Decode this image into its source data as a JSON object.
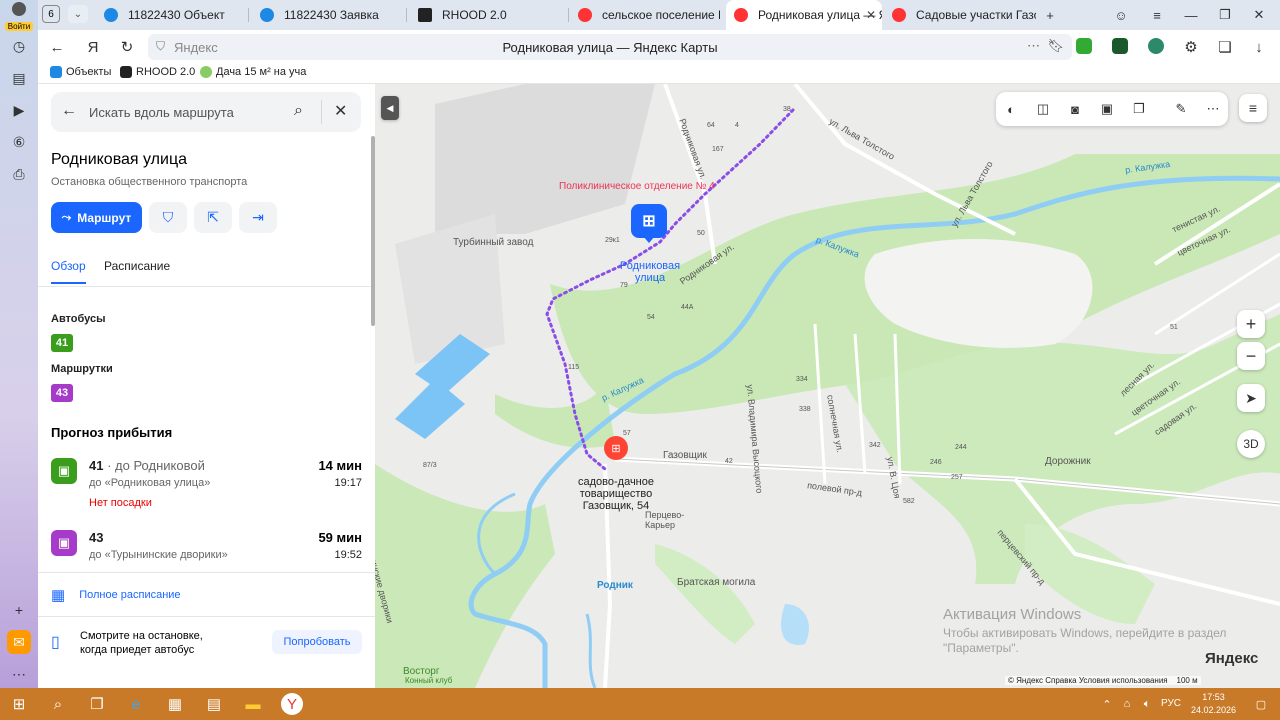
{
  "browser": {
    "login_label": "Войти",
    "tab_count": "6",
    "tabs": [
      {
        "title": "11822430 Объект",
        "active": false
      },
      {
        "title": "11822430 Заявка",
        "active": false
      },
      {
        "title": "RHOOD 2.0",
        "active": false
      },
      {
        "title": "сельское поселение Кра",
        "active": false
      },
      {
        "title": "Родниковая улица — Я",
        "active": true
      },
      {
        "title": "Садовые участки Газови",
        "active": false
      }
    ],
    "url_domain": "Яндекс",
    "page_title": "Родниковая улица — Яндекс Карты",
    "bookmarks": [
      "Объекты",
      "RHOOD 2.0",
      "Дача 15 м² на уча"
    ]
  },
  "panel": {
    "search_placeholder": "Искать вдоль маршрута",
    "title": "Родниковая улица",
    "subtitle": "Остановка общественного транспорта",
    "route_button": "Маршрут",
    "tabs": [
      "Обзор",
      "Расписание"
    ],
    "buses_label": "Автобусы",
    "bus_number": "41",
    "minibus_label": "Маршрутки",
    "minibus_number": "43",
    "forecast_title": "Прогноз прибытия",
    "arrivals": [
      {
        "number": "41",
        "direction": " · до Родниковой",
        "destination": "до «Родниковая улица»",
        "warning": "Нет посадки",
        "minutes": "14 мин",
        "time": "19:17"
      },
      {
        "number": "43",
        "direction": "",
        "destination": "до «Турынинские дворики»",
        "warning": "",
        "minutes": "59 мин",
        "time": "19:52"
      }
    ],
    "full_schedule": "Полное расписание",
    "promo_text": "Смотрите на остановке, когда приедет автобус",
    "promo_button": "Попробовать"
  },
  "map": {
    "stop_label": "Родниковая улица",
    "destination_label": "садово-дачное товарищество Газовщик, 54",
    "labels": {
      "clinic": "Поликлиническое отделение № 4",
      "factory": "Турбинный завод",
      "river1": "р. Калужка",
      "river2": "р. Калужка",
      "river3": "р. Калужка",
      "tolstoy": "ул. Льва Толстого",
      "tolstoy2": "ул. Льва Толстого",
      "rodnikovaya": "Родниковая ул.",
      "rodnikovaya2": "Родниковая ул.",
      "gazovshchik": "Газовщик",
      "pertsevo": "Перцево-Карьер",
      "rodnik": "Родник",
      "grave": "Братская могила",
      "polevoy": "полевой пр-д",
      "pertsevsky": "перцевский пр-д",
      "dorozhnik": "Дорожник",
      "vostorg": "Восторг",
      "vostorg_sub": "Конный клуб",
      "vysotsky": "ул. Владимира Высоцкого",
      "solnechnaya": "солнечная ул.",
      "tsoy": "ул. В. Цоя",
      "lesnaya": "лесная ул.",
      "tsvetochnaya": "цветочная ул.",
      "sadovaya": "садовая ул.",
      "tenistaya": "тенистая ул.",
      "tsvetochnaya2": "цветочная ул.",
      "turyninskie": "нинские дворики",
      "h167": "167",
      "h4": "4",
      "h64": "64",
      "h38": "38",
      "h29k1": "29к1",
      "h50": "50",
      "h79": "79",
      "h54": "54",
      "h44a": "44А",
      "h115": "115",
      "h57": "57",
      "h42": "42",
      "h334": "334",
      "h338": "338",
      "h342": "342",
      "h246": "246",
      "h257": "257",
      "h244": "244",
      "h582": "582",
      "h87": "87/3",
      "h51": "51"
    },
    "activation_title": "Активация Windows",
    "activation_text": "Чтобы активировать Windows, перейдите в раздел \"Параметры\".",
    "logo": "Яндекс",
    "copyright": "© Яндекс   Справка   Условия использования",
    "scale": "100 м",
    "btn_3d": "3D",
    "accent": "#1a66ff"
  },
  "taskbar": {
    "lang": "РУС",
    "time": "17:53",
    "date": "24.02.2026"
  }
}
